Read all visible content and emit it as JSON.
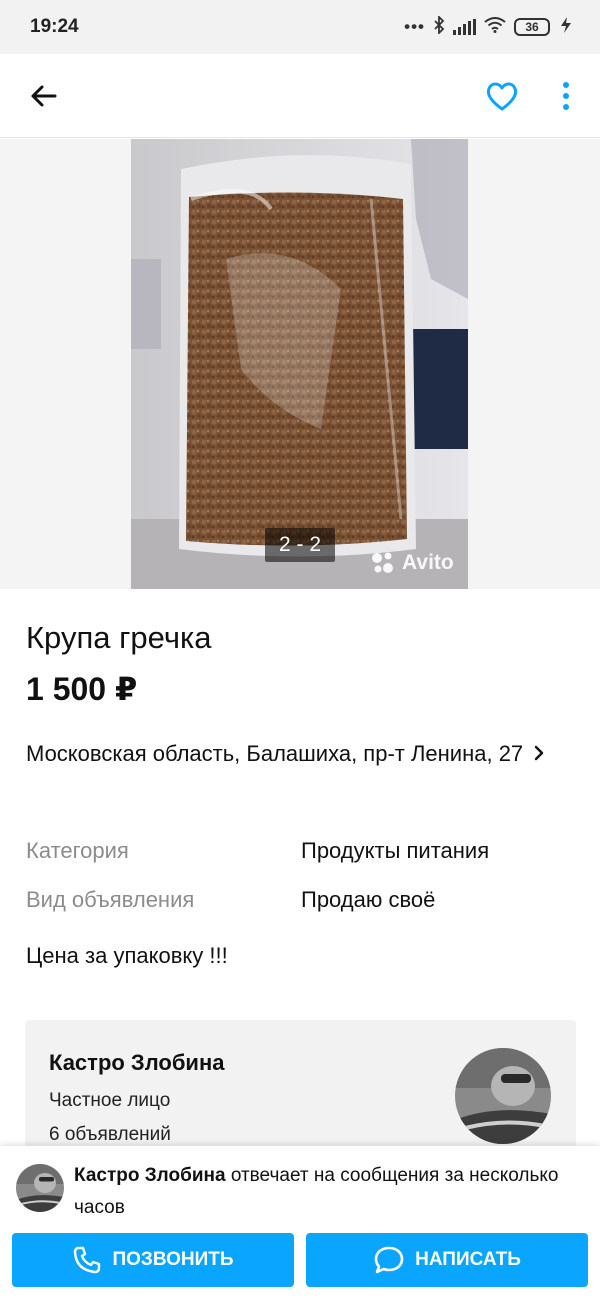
{
  "status_bar": {
    "time": "19:24",
    "battery": "36"
  },
  "app_bar": {
    "back_icon": "arrow-left-icon",
    "favorite_icon": "heart-icon",
    "menu_icon": "more-vertical-icon",
    "accent_color": "#0aa5ff"
  },
  "gallery": {
    "counter": "2 - 2",
    "watermark": "Avito"
  },
  "listing": {
    "title": "Крупа гречка",
    "price": "1 500 ₽",
    "address": "Московская область, Балашиха, пр-т Ленина, 27",
    "params": [
      {
        "label": "Категория",
        "value": "Продукты питания"
      },
      {
        "label": "Вид объявления",
        "value": "Продаю своё"
      }
    ],
    "description": "Цена за упаковку !!!"
  },
  "seller": {
    "name": "Кастро Злобина",
    "type": "Частное лицо",
    "ads_count": "6 объявлений"
  },
  "bottom_panel": {
    "seller_name": "Кастро Злобина",
    "reply_text": " отвечает на сообщения за несколько часов",
    "call_label": "ПОЗВОНИТЬ",
    "write_label": "НАПИСАТЬ"
  }
}
